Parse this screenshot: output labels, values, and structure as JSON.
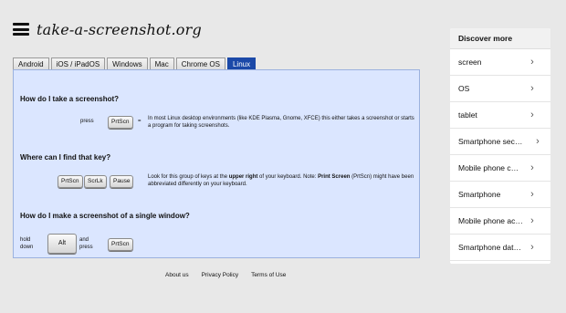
{
  "header": {
    "menu_icon": "hamburger-icon",
    "logo": "take-a-screenshot.org"
  },
  "tabs": [
    "Android",
    "iOS / iPadOS",
    "Windows",
    "Mac",
    "Chrome OS",
    "Linux"
  ],
  "active_tab": "Linux",
  "q1": {
    "title": "How do I take a screenshot?",
    "press_label": "press",
    "key": "PrtScn",
    "equals": "=",
    "desc_line1": "In most Linux desktop environments (like KDE Plasma, Gnome, XFCE) this either takes a screenshot or starts",
    "desc_line2": "a program for taking screenshots."
  },
  "q2": {
    "title": "Where can I find that key?",
    "keys": [
      "PrtScn",
      "ScrLk",
      "Pause"
    ],
    "desc_line1a": "Look for this group of keys at the ",
    "desc_line1b": "upper right",
    "desc_line1c": " of your keyboard. Note: ",
    "desc_line1d": "Print Screen",
    "desc_line1e": " (PrtScn) might have been",
    "desc_line2": "abbreviated differently on your keyboard."
  },
  "q3": {
    "title": "How do I make a screenshot of a single window?",
    "hold": "hold",
    "down": "down",
    "key_alt": "Alt",
    "and": "and",
    "press": "press",
    "key": "PrtScn"
  },
  "footer": [
    "About us",
    "Privacy Policy",
    "Terms of Use"
  ],
  "sidebar": {
    "title": "Discover more",
    "items": [
      "screen",
      "OS",
      "tablet",
      "Smartphone sec…",
      "Mobile phone c…",
      "Smartphone",
      "Mobile phone ac…",
      "Smartphone dat…"
    ]
  }
}
